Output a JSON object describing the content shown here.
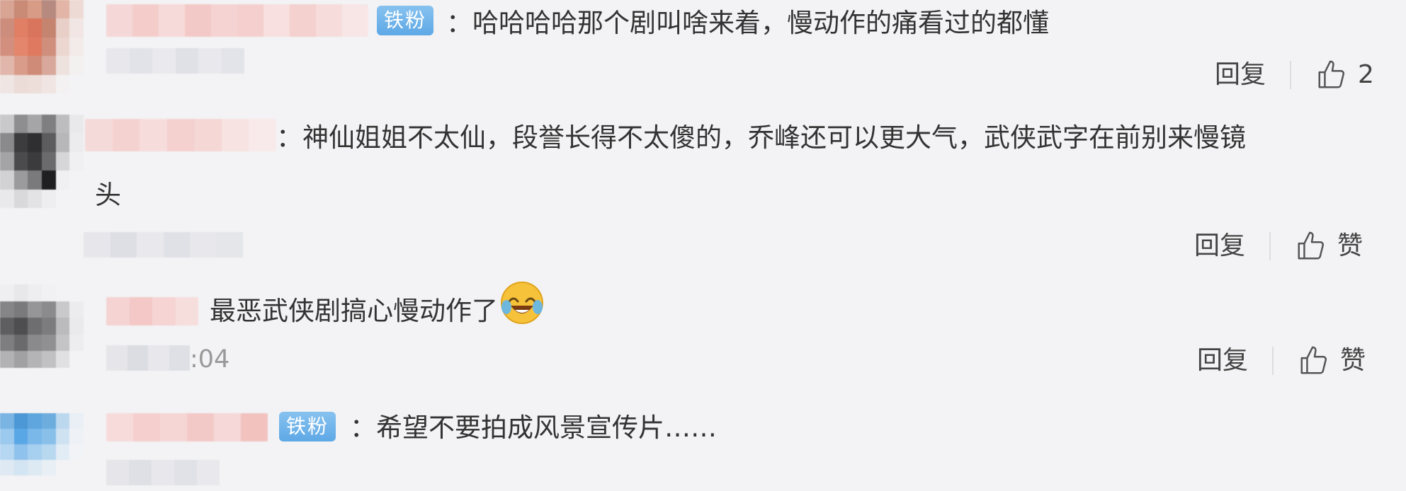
{
  "comments": [
    {
      "badge": "铁粉",
      "text": "：哈哈哈哈那个剧叫啥来着，慢动作的痛看过的都懂",
      "reply_label": "回复",
      "like_label": "2"
    },
    {
      "text_line1": "：神仙姐姐不太仙，段誉长得不太傻的，乔峰还可以更大气，武侠武字在前别来慢镜",
      "text_line2": "头",
      "reply_label": "回复",
      "like_label": "赞"
    },
    {
      "text": "最恶武侠剧搞心慢动作了",
      "emoji": "laughing-tears-emoji",
      "time_partial": ":04",
      "reply_label": "回复",
      "like_label": "赞"
    },
    {
      "badge": "铁粉",
      "text": "：希望不要拍成风景宣传片……"
    }
  ],
  "icons": {
    "like": "thumbs-up-icon"
  },
  "colors": {
    "background": "#f3f3f5",
    "badge": "#6cb3ea",
    "text": "#333333",
    "muted": "#999999"
  }
}
